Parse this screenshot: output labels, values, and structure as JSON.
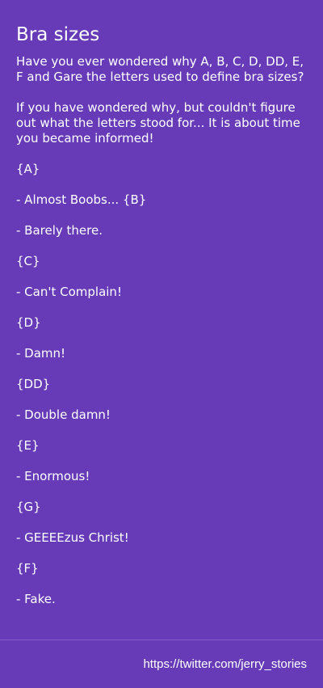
{
  "post": {
    "title": "Bra sizes",
    "paragraphs": [
      "Have you ever wondered why A, B, C, D, DD, E, F and Gare the letters used to define bra sizes?",
      "If you have wondered why, but couldn't figure out what the letters stood for... It is about time you became informed!",
      "{A}",
      "- Almost Boobs... {B}",
      "- Barely there.",
      "{C}",
      "- Can't Complain!",
      "{D}",
      "- Damn!",
      "{DD}",
      "- Double damn!",
      "{E}",
      "- Enormous!",
      "{G}",
      "- GEEEEzus Christ!",
      "{F}",
      "- Fake."
    ]
  },
  "footer": {
    "source_link": "https://twitter.com/jerry_stories"
  },
  "colors": {
    "background": "#673ab7",
    "text": "#ffffff"
  }
}
